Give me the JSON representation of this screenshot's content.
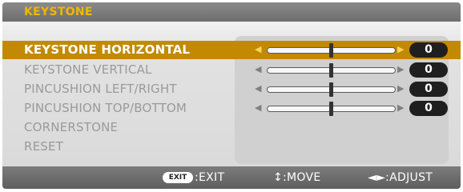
{
  "title": "KEYSTONE",
  "menu": [
    {
      "label": "KEYSTONE HORIZONTAL",
      "selected": true,
      "value": "0",
      "level": 0.5
    },
    {
      "label": "KEYSTONE VERTICAL",
      "selected": false,
      "value": "0",
      "level": 0.5
    },
    {
      "label": "PINCUSHION LEFT/RIGHT",
      "selected": false,
      "value": "0",
      "level": 0.5
    },
    {
      "label": "PINCUSHION TOP/BOTTOM",
      "selected": false,
      "value": "0",
      "level": 0.5
    },
    {
      "label": "CORNERSTONE",
      "selected": false
    },
    {
      "label": "RESET",
      "selected": false
    }
  ],
  "footer": {
    "exit_badge": "EXIT",
    "exit_label": ":EXIT",
    "move_label": "↕:MOVE",
    "adjust_label": "◄►:ADJUST"
  },
  "icons": {
    "left_arrow": "left-arrow-icon",
    "right_arrow": "right-arrow-icon"
  },
  "colors": {
    "title": "#f2b600",
    "selection": "#c28a02",
    "value_pill": "#1f1f1f"
  }
}
